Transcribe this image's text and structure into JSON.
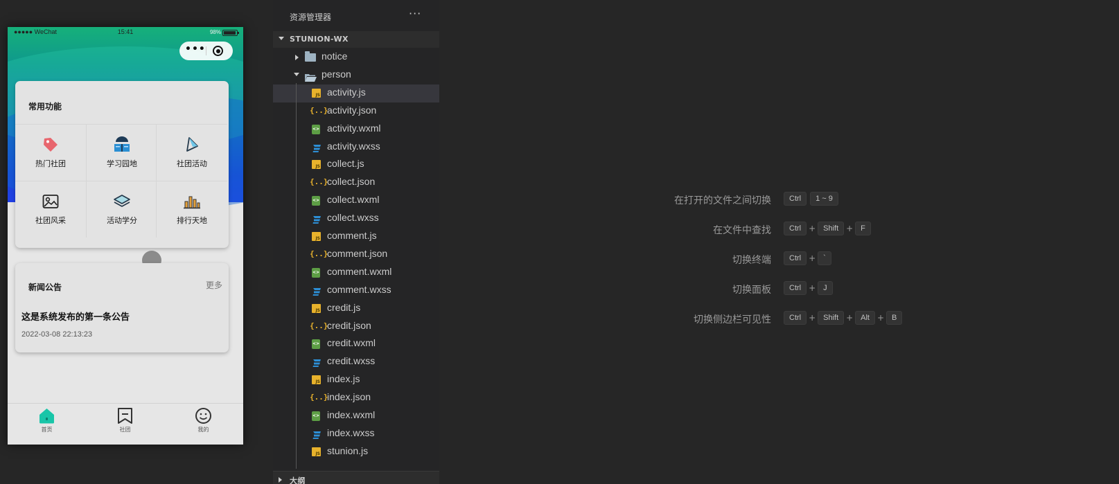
{
  "simulator": {
    "status": {
      "carrier": "●●●●● WeChat",
      "time": "15:41",
      "battery": "98%"
    },
    "capsule": {
      "more": "•••"
    },
    "common": {
      "title": "常用功能",
      "items": [
        {
          "label": "热门社团",
          "icon": "tag-icon"
        },
        {
          "label": "学习园地",
          "icon": "book-reader-icon"
        },
        {
          "label": "社团活动",
          "icon": "flag-icon"
        },
        {
          "label": "社团风采",
          "icon": "image-icon"
        },
        {
          "label": "活动学分",
          "icon": "layers-icon"
        },
        {
          "label": "排行天地",
          "icon": "bar-chart-icon"
        }
      ]
    },
    "news": {
      "title": "新闻公告",
      "more": "更多",
      "item_title": "这是系统发布的第一条公告",
      "item_time": "2022-03-08 22:13:23"
    },
    "tabs": [
      {
        "label": "首页",
        "icon": "home-icon",
        "active": true
      },
      {
        "label": "社团",
        "icon": "bookmark-icon",
        "active": false
      },
      {
        "label": "我的",
        "icon": "smile-icon",
        "active": false
      }
    ],
    "colors": {
      "accent": "#19c5a8"
    }
  },
  "explorer": {
    "title": "资源管理器",
    "more": "···",
    "root": "STUNION-WX",
    "outline": "大纲",
    "folders": [
      {
        "name": "notice",
        "expanded": false
      },
      {
        "name": "person",
        "expanded": true
      }
    ],
    "files": [
      {
        "name": "activity.js",
        "type": "js",
        "selected": true
      },
      {
        "name": "activity.json",
        "type": "json"
      },
      {
        "name": "activity.wxml",
        "type": "wxml"
      },
      {
        "name": "activity.wxss",
        "type": "wxss"
      },
      {
        "name": "collect.js",
        "type": "js"
      },
      {
        "name": "collect.json",
        "type": "json"
      },
      {
        "name": "collect.wxml",
        "type": "wxml"
      },
      {
        "name": "collect.wxss",
        "type": "wxss"
      },
      {
        "name": "comment.js",
        "type": "js"
      },
      {
        "name": "comment.json",
        "type": "json"
      },
      {
        "name": "comment.wxml",
        "type": "wxml"
      },
      {
        "name": "comment.wxss",
        "type": "wxss"
      },
      {
        "name": "credit.js",
        "type": "js"
      },
      {
        "name": "credit.json",
        "type": "json"
      },
      {
        "name": "credit.wxml",
        "type": "wxml"
      },
      {
        "name": "credit.wxss",
        "type": "wxss"
      },
      {
        "name": "index.js",
        "type": "js"
      },
      {
        "name": "index.json",
        "type": "json"
      },
      {
        "name": "index.wxml",
        "type": "wxml"
      },
      {
        "name": "index.wxss",
        "type": "wxss"
      },
      {
        "name": "stunion.js",
        "type": "js"
      }
    ],
    "json_glyph": "{..}"
  },
  "shortcuts": [
    {
      "label": "在打开的文件之间切换",
      "keys": [
        "Ctrl",
        "1 ~ 9"
      ],
      "joined": false
    },
    {
      "label": "在文件中查找",
      "keys": [
        "Ctrl",
        "Shift",
        "F"
      ],
      "joined": true
    },
    {
      "label": "切换终端",
      "keys": [
        "Ctrl",
        "`"
      ],
      "joined": true
    },
    {
      "label": "切换面板",
      "keys": [
        "Ctrl",
        "J"
      ],
      "joined": true
    },
    {
      "label": "切换侧边栏可见性",
      "keys": [
        "Ctrl",
        "Shift",
        "Alt",
        "B"
      ],
      "joined": true
    }
  ],
  "plus_sign": "+"
}
